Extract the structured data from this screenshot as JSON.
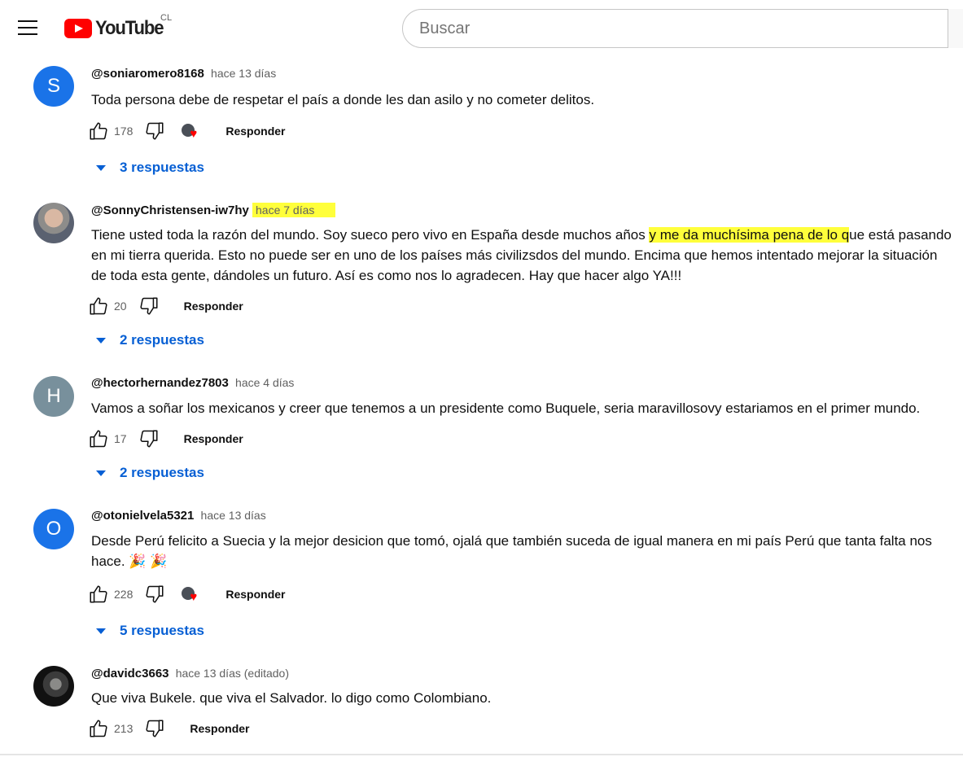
{
  "header": {
    "logo_text": "YouTube",
    "country_code": "CL",
    "search_placeholder": "Buscar"
  },
  "colors": {
    "brand_red": "#ff0000",
    "link_blue": "#065fd4",
    "highlight_yellow": "#ffff3b"
  },
  "comments": [
    {
      "avatar_letter": "S",
      "avatar_color": "#1a73e8",
      "author": "@soniaromero8168",
      "time": "hace 13 días",
      "text": "Toda persona debe de respetar el país a donde les dan asilo y no cometer delitos.",
      "likes": "178",
      "creator_heart": true,
      "reply_label": "Responder",
      "replies_label": "3 respuestas"
    },
    {
      "avatar_letter": "",
      "avatar_color": "#7d6f63",
      "author": "@SonnyChristensen-iw7hy",
      "time": "hace 7 días",
      "text_before": "Tiene usted toda la razón del mundo. Soy sueco pero vivo en España desde muchos años ",
      "text_highlight": "y me da muchísima pena de lo q",
      "text_after": "ue está pasando en mi tierra querida. Esto no puede ser en uno de los países más  civilizsdos del mundo. Encima que hemos intentado mejorar la situación de toda esta gente, dándoles un futuro. Así es como nos lo agradecen. Hay que hacer algo YA!!!",
      "likes": "20",
      "reply_label": "Responder",
      "replies_label": "2 respuestas"
    },
    {
      "avatar_letter": "H",
      "avatar_color": "#78909c",
      "author": "@hectorhernandez7803",
      "time": "hace 4 días",
      "text": "Vamos a soñar los mexicanos y creer que tenemos a un presidente como Buquele, seria maravillosovy estariamos en el primer mundo.",
      "likes": "17",
      "reply_label": "Responder",
      "replies_label": "2 respuestas"
    },
    {
      "avatar_letter": "O",
      "avatar_color": "#1a73e8",
      "author": "@otonielvela5321",
      "time": "hace 13 días",
      "text": "Desde Perú felicito a  Suecia y la mejor desicion que tomó,  ojalá que  también suceda de igual manera  en mi país  Perú  que  tanta falta nos hace. 🎉 🎉",
      "likes": "228",
      "creator_heart": true,
      "reply_label": "Responder",
      "replies_label": "5 respuestas"
    },
    {
      "avatar_letter": "",
      "avatar_color": "#1b1b1b",
      "author": "@davidc3663",
      "time": "hace 13 días (editado)",
      "text": "Que viva Bukele. que viva el Salvador. lo digo como Colombiano.",
      "likes": "213",
      "reply_label": "Responder"
    }
  ]
}
